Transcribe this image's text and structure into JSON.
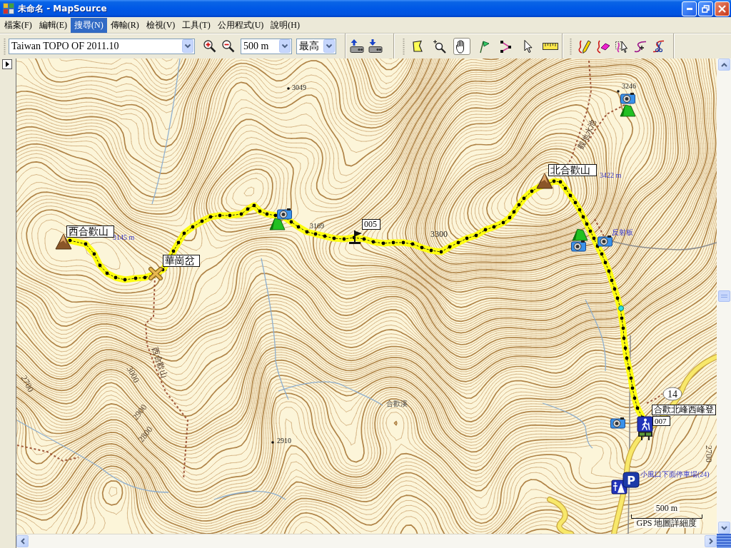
{
  "window": {
    "title": "未命名 - MapSource"
  },
  "menu": [
    {
      "label": "檔案(F)",
      "selected": false
    },
    {
      "label": "編輯(E)",
      "selected": false
    },
    {
      "label": "搜尋(N)",
      "selected": true
    },
    {
      "label": "傳輸(R)",
      "selected": false
    },
    {
      "label": "檢視(V)",
      "selected": false
    },
    {
      "label": "工具(T)",
      "selected": false
    },
    {
      "label": "公用程式(U)",
      "selected": false
    },
    {
      "label": "說明(H)",
      "selected": false
    }
  ],
  "toolbar": {
    "map_product": "Taiwan TOPO OF 2011.10",
    "zoom_scale": "500 m",
    "detail": "最高",
    "tools": [
      {
        "kind": "area",
        "selected": false
      },
      {
        "kind": "zoom",
        "selected": false
      },
      {
        "kind": "pan",
        "selected": true
      },
      {
        "kind": "waypoint",
        "selected": false
      },
      {
        "kind": "route",
        "selected": false
      },
      {
        "kind": "select",
        "selected": false
      },
      {
        "kind": "measure",
        "selected": false
      }
    ],
    "track_tools": [
      {
        "kind": "draw",
        "selected": false
      },
      {
        "kind": "erase",
        "selected": false
      },
      {
        "kind": "pick",
        "selected": false
      },
      {
        "kind": "insert",
        "selected": false
      },
      {
        "kind": "cut",
        "selected": false
      }
    ]
  },
  "map": {
    "waypoints": [
      {
        "label": "西合歡山",
        "kind": "summit"
      },
      {
        "label": "華崗岔",
        "kind": "crossing"
      },
      {
        "label": "005",
        "kind": "flag"
      },
      {
        "label": "北合歡山",
        "kind": "summit"
      },
      {
        "label": "合歡北峰西峰登",
        "kind": "trailhead"
      },
      {
        "label": "007",
        "kind": "sign"
      }
    ],
    "texts": [
      {
        "text": "3049",
        "kind": "spot"
      },
      {
        "text": "3169",
        "kind": "spot"
      },
      {
        "text": "3300",
        "kind": "peak"
      },
      {
        "text": "3246",
        "kind": "spot"
      },
      {
        "text": "2910",
        "kind": "spot"
      },
      {
        "text": "合歡溪",
        "kind": "stream"
      },
      {
        "text": "3000",
        "kind": "contour"
      },
      {
        "text": "2900",
        "kind": "contour"
      },
      {
        "text": "2800",
        "kind": "contour"
      },
      {
        "text": "2700",
        "kind": "contour"
      },
      {
        "text": "2700",
        "kind": "contour"
      },
      {
        "text": "西合歡山",
        "kind": "trail"
      },
      {
        "text": "觀地水池",
        "kind": "trail"
      },
      {
        "text": "3145 m",
        "kind": "poi"
      },
      {
        "text": "3422 m",
        "kind": "poi"
      },
      {
        "text": "反射板",
        "kind": "poi"
      },
      {
        "text": "小風口下面停車場(24)",
        "kind": "poi"
      }
    ],
    "route_number": "14",
    "parking_sign": "P",
    "scale": {
      "distance": "500 m",
      "detail_label": "GPS 地圖詳細度"
    }
  }
}
